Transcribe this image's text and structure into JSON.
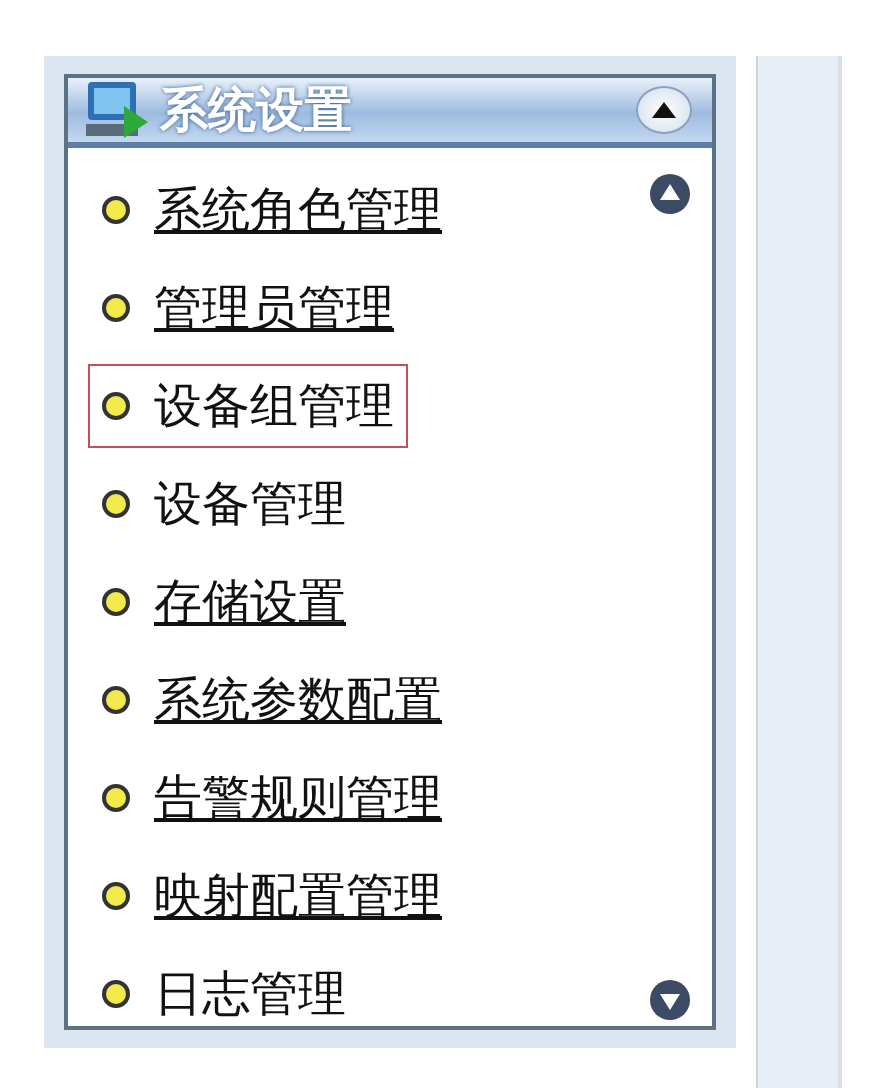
{
  "panel": {
    "title": "系统设置",
    "expanded": true
  },
  "menu": [
    {
      "label": "系统角色管理",
      "underlined": true,
      "selected": false
    },
    {
      "label": "管理员管理",
      "underlined": true,
      "selected": false
    },
    {
      "label": "设备组管理",
      "underlined": false,
      "selected": true
    },
    {
      "label": "设备管理",
      "underlined": false,
      "selected": false
    },
    {
      "label": "存储设置",
      "underlined": true,
      "selected": false
    },
    {
      "label": "系统参数配置",
      "underlined": true,
      "selected": false
    },
    {
      "label": "告警规则管理",
      "underlined": true,
      "selected": false
    },
    {
      "label": "映射配置管理",
      "underlined": true,
      "selected": false
    },
    {
      "label": "日志管理",
      "underlined": false,
      "selected": false
    }
  ]
}
